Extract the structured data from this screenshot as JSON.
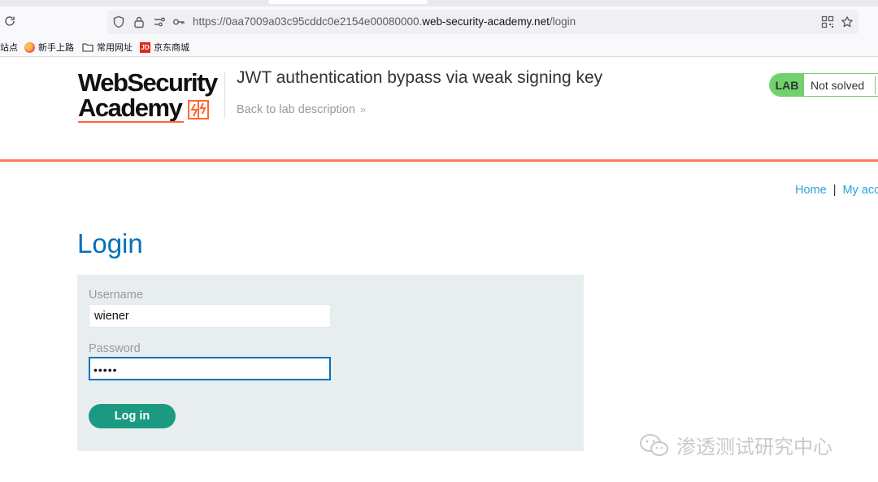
{
  "browser": {
    "url_prefix": "https://0aa7009a03c95cddc0e2154e00080000.",
    "url_domain": "web-security-academy.net",
    "url_path": "/login"
  },
  "bookmarks": [
    {
      "label": "站点",
      "icon": "bookmark-folder"
    },
    {
      "label": "新手上路",
      "icon": "firefox-icon"
    },
    {
      "label": "常用网址",
      "icon": "folder-icon"
    },
    {
      "label": "京东商城",
      "icon": "jd-icon"
    }
  ],
  "logo": {
    "line1": "WebSecurity",
    "line2": "Academy"
  },
  "lab": {
    "title": "JWT authentication bypass via weak signing key",
    "back_link": "Back to lab description",
    "badge": "LAB",
    "status": "Not solved",
    "status_color": "#70d16d"
  },
  "nav": {
    "home": "Home",
    "separator": "|",
    "account": "My acc"
  },
  "login": {
    "heading": "Login",
    "username_label": "Username",
    "username_value": "wiener",
    "password_label": "Password",
    "password_value": "•••••",
    "submit_label": "Log in"
  },
  "watermark": {
    "text": "渗透测试研究中心"
  },
  "colors": {
    "accent_orange": "#ff6633",
    "link_blue": "#29a3dc",
    "heading_blue": "#0071bc",
    "button_green": "#1b9a82"
  }
}
